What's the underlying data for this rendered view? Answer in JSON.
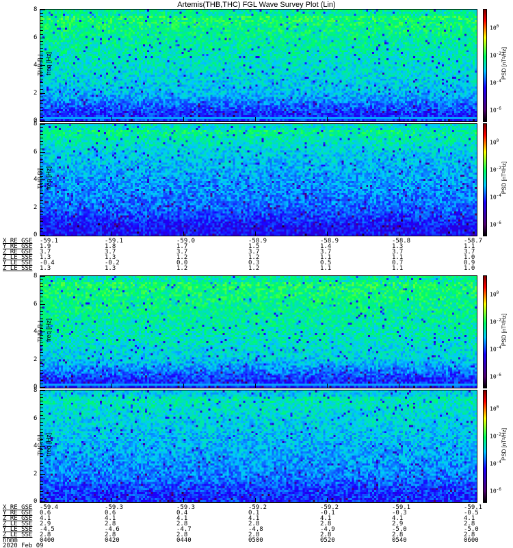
{
  "title": "Artemis(THB,THC) FGL Wave Survey Plot (Lin)",
  "panels": [
    {
      "label": "THB B⊥",
      "ylabel": "freq [Hz]",
      "cbar_label": "PSD [nT²/Hz]"
    },
    {
      "label": "THB B∥",
      "ylabel": "freq [Hz]",
      "cbar_label": "PSD [nT²/Hz]"
    },
    {
      "label": "THB B⊥",
      "ylabel": "freq [Hz]",
      "cbar_label": "PSD [nT²/Hz]"
    },
    {
      "label": "THC B∥",
      "ylabel": "freq [Hz]",
      "cbar_label": "PSD [nT²/Hz]"
    }
  ],
  "yticks": [
    "0",
    "2",
    "4",
    "6",
    "8"
  ],
  "cbar_ticks": [
    {
      "base": "10",
      "exp": "0"
    },
    {
      "base": "10",
      "exp": "-2"
    },
    {
      "base": "10",
      "exp": "-4"
    },
    {
      "base": "10",
      "exp": "-6"
    }
  ],
  "orbit_top": {
    "labels": [
      "X_RE_GSE",
      "Y_RE_GSE",
      "Z_RE_GSE",
      "Z_LE_SSE",
      "Y_LE_SSE",
      "Z_LE_SSE"
    ],
    "rows": [
      [
        "-59.1",
        "-59.1",
        "-59.0",
        "-58.9",
        "-58.9",
        "-58.8",
        "-58.7"
      ],
      [
        "1.9",
        "1.8",
        "1.7",
        "1.5",
        "1.4",
        "1.3",
        "1.1"
      ],
      [
        "3.7",
        "3.7",
        "3.7",
        "3.7",
        "3.7",
        "3.7",
        "3.7"
      ],
      [
        "1.3",
        "1.3",
        "1.2",
        "1.2",
        "1.1",
        "1.1",
        "1.0"
      ],
      [
        "-0.4",
        "-0.2",
        "0.0",
        "0.3",
        "0.5",
        "0.7",
        "0.9"
      ],
      [
        "1.3",
        "1.3",
        "1.2",
        "1.2",
        "1.1",
        "1.1",
        "1.0"
      ]
    ]
  },
  "orbit_bottom": {
    "labels": [
      "X_RE_GSE",
      "Y_RE_GSE",
      "Z_RE_GSE",
      "Z_LE_SSE",
      "Y_LE_SSE",
      "Z_LE_SSE",
      "hhmm"
    ],
    "rows": [
      [
        "-59.4",
        "-59.3",
        "-59.3",
        "-59.2",
        "-59.2",
        "-59.1",
        "-59.1"
      ],
      [
        "0.6",
        "0.6",
        "0.4",
        "0.1",
        "-0.1",
        "-0.3",
        "-0.5"
      ],
      [
        "4.1",
        "4.1",
        "4.1",
        "4.1",
        "4.1",
        "4.1",
        "4.1"
      ],
      [
        "2.9",
        "2.8",
        "2.8",
        "2.8",
        "2.8",
        "2.9",
        "2.8"
      ],
      [
        "-4.5",
        "-4.6",
        "-4.7",
        "-4.8",
        "-4.9",
        "-5.0",
        "-5.0"
      ],
      [
        "2.8",
        "2.8",
        "2.8",
        "2.8",
        "2.8",
        "2.8",
        "2.8"
      ],
      [
        "0400",
        "0420",
        "0440",
        "0500",
        "0520",
        "0540",
        "0600"
      ]
    ],
    "date": "2020 Feb 09"
  },
  "chart_data": {
    "type": "heatmap",
    "title": "Artemis(THB,THC) FGL Wave Survey Plot (Lin)",
    "xlabel": "hhmm",
    "x_ticks": [
      "0400",
      "0420",
      "0440",
      "0500",
      "0520",
      "0540",
      "0600"
    ],
    "ylabel": "freq [Hz]",
    "ylim": [
      0,
      8
    ],
    "colorbar": {
      "label": "PSD [nT²/Hz]",
      "scale": "log",
      "ticks": [
        "1e0",
        "1e-2",
        "1e-4",
        "1e-6"
      ]
    },
    "series": [
      {
        "name": "THB B⊥",
        "mean_level": [
          0.33,
          0.45,
          0.5,
          0.54,
          0.58
        ]
      },
      {
        "name": "THB B∥",
        "mean_level": [
          0.3,
          0.38,
          0.42,
          0.47,
          0.55
        ]
      },
      {
        "name": "THB B⊥",
        "mean_level": [
          0.33,
          0.47,
          0.52,
          0.55,
          0.58
        ]
      },
      {
        "name": "THC B∥",
        "mean_level": [
          0.33,
          0.4,
          0.44,
          0.48,
          0.52
        ]
      }
    ],
    "mean_level_freqs_hz": [
      0.5,
      2,
      4,
      6,
      7.5
    ]
  }
}
